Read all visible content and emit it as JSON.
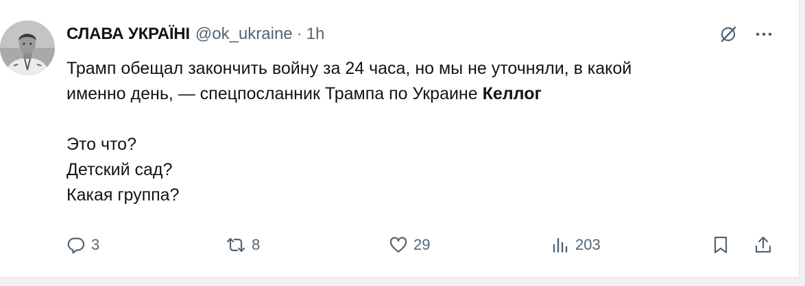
{
  "tweet": {
    "author": {
      "display_name": "СЛАВА УКРАЇНІ",
      "handle": "@ok_ukraine",
      "separator": "·",
      "time": "1h",
      "avatar_icon": "avatar-photo"
    },
    "text": {
      "line1": "Трамп обещал закончить войну за 24 часа, но мы не уточняли, в какой",
      "line2_plain": "именно день, — спецпосланник Трампа по Украине ",
      "line2_bold": "Келлог",
      "line3": "Это что?",
      "line4": "Детский сад?",
      "line5": "Какая группа?"
    },
    "header_icons": [
      "grok-icon",
      "more-icon"
    ],
    "actions": {
      "replies": "3",
      "retweets": "8",
      "likes": "29",
      "views": "203"
    }
  },
  "colors": {
    "text_primary": "#0f1419",
    "text_secondary": "#536471",
    "background": "#ffffff"
  }
}
